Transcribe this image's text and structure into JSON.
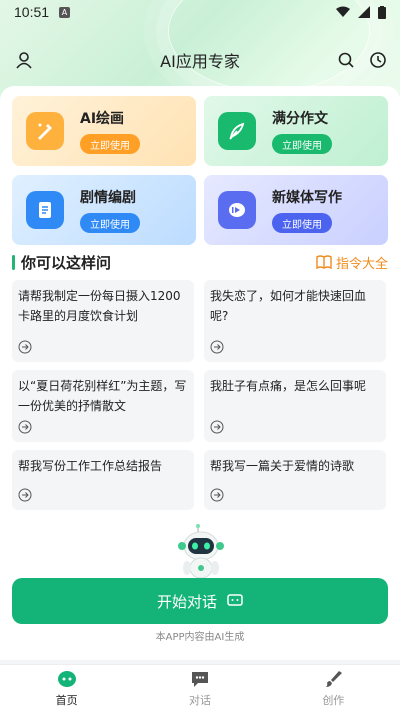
{
  "status_bar": {
    "time": "10:51",
    "notif_letter": "A"
  },
  "header": {
    "title": "AI应用专家"
  },
  "features": [
    {
      "title": "AI绘画",
      "button": "立即使用"
    },
    {
      "title": "满分作文",
      "button": "立即使用"
    },
    {
      "title": "剧情编剧",
      "button": "立即使用"
    },
    {
      "title": "新媒体写作",
      "button": "立即使用"
    }
  ],
  "section": {
    "title": "你可以这样问",
    "link": "指令大全"
  },
  "prompts": [
    {
      "text": "请帮我制定一份每日摄入1200卡路里的月度饮食计划"
    },
    {
      "text": "我失恋了，如何才能快速回血呢?"
    },
    {
      "text": "以“夏日荷花别样红”为主题，写一份优美的抒情散文"
    },
    {
      "text": "我肚子有点痛，是怎么回事呢"
    },
    {
      "text": "帮我写份工作工作总结报告"
    },
    {
      "text": "帮我写一篇关于爱情的诗歌"
    }
  ],
  "start_button": {
    "label": "开始对话"
  },
  "ai_note": "本APP内容由AI生成",
  "tabs": [
    {
      "label": "首页",
      "active": true
    },
    {
      "label": "对话",
      "active": false
    },
    {
      "label": "创作",
      "active": false
    }
  ],
  "colors": {
    "accent": "#14b478",
    "link": "#f08c1e"
  }
}
